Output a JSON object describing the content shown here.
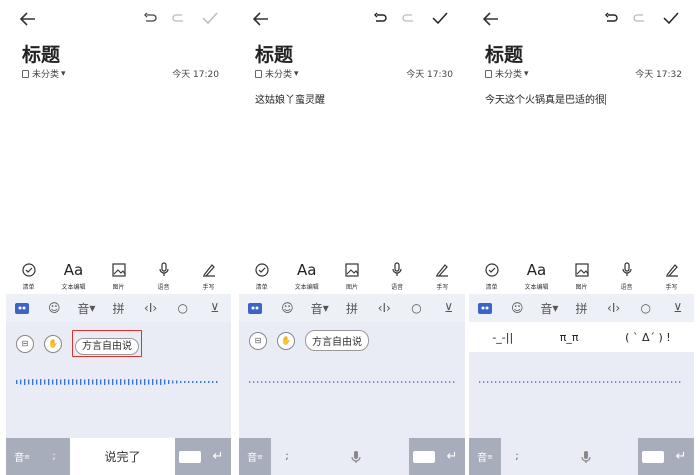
{
  "panels": [
    {
      "title": "标题",
      "category": "未分类",
      "time": "今天 17:20",
      "body": "",
      "tools": [
        {
          "label": "清单",
          "icon": "checklist-icon"
        },
        {
          "label": "文本编辑",
          "icon": "text-format-icon",
          "glyph": "Aa"
        },
        {
          "label": "图片",
          "icon": "image-icon"
        },
        {
          "label": "语音",
          "icon": "microphone-icon"
        },
        {
          "label": "手写",
          "icon": "pen-icon"
        }
      ],
      "keyboard_bar": {
        "voice": "音",
        "pinyin": "拼"
      },
      "voice_chip": "方言自由说",
      "bottom": {
        "left": "音",
        "center": "说完了"
      }
    },
    {
      "title": "标题",
      "category": "未分类",
      "time": "今天 17:30",
      "body": "这姑娘丫蛮灵醒",
      "tools": [
        {
          "label": "清单",
          "icon": "checklist-icon"
        },
        {
          "label": "文本编辑",
          "icon": "text-format-icon",
          "glyph": "Aa"
        },
        {
          "label": "图片",
          "icon": "image-icon"
        },
        {
          "label": "语音",
          "icon": "microphone-icon"
        },
        {
          "label": "手写",
          "icon": "pen-icon"
        }
      ],
      "keyboard_bar": {
        "voice": "音",
        "pinyin": "拼"
      },
      "voice_chip": "方言自由说",
      "bottom": {
        "left": "音"
      }
    },
    {
      "title": "标题",
      "category": "未分类",
      "time": "今天 17:32",
      "body": "今天这个火锅真是巴适的很",
      "tools": [
        {
          "label": "清单",
          "icon": "checklist-icon"
        },
        {
          "label": "文本编辑",
          "icon": "text-format-icon",
          "glyph": "Aa"
        },
        {
          "label": "图片",
          "icon": "image-icon"
        },
        {
          "label": "语音",
          "icon": "microphone-icon"
        },
        {
          "label": "手写",
          "icon": "pen-icon"
        }
      ],
      "keyboard_bar": {
        "voice": "音",
        "pinyin": "拼"
      },
      "emoticons": [
        "-_-||",
        "π_π",
        "( ˋ Δˊ ) !"
      ],
      "bottom": {
        "left": "音"
      }
    }
  ],
  "colors": {
    "accent": "#2d6fe0",
    "highlight": "#e0302f",
    "keyboard_bg": "#e9ecf4"
  }
}
